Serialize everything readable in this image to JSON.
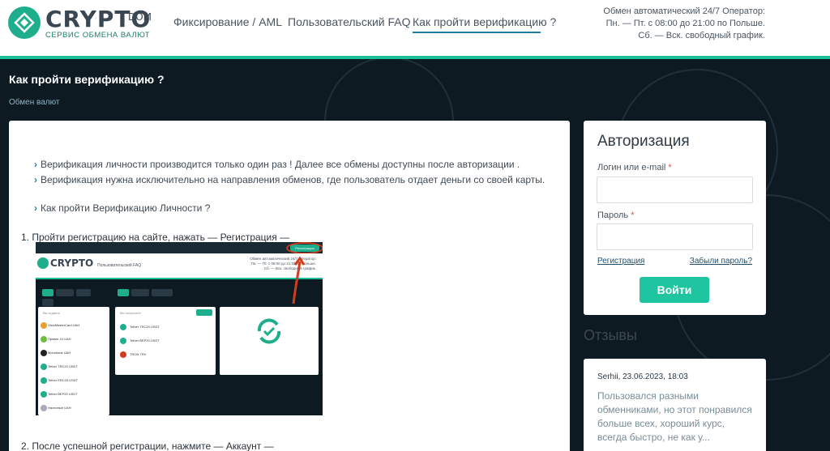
{
  "header": {
    "logo_text": "CRYPTO",
    "logo_dom": "DOM",
    "logo_sub": "СЕРВИС  ОБМЕНА  ВАЛЮТ",
    "nav": [
      {
        "label": "Фиксирование / AML"
      },
      {
        "label": "Пользовательский FAQ"
      },
      {
        "label": "Как пройти верификацию ?"
      }
    ],
    "ops_lines": [
      "Обмен автоматический 24/7 Оператор:",
      "Пн. — Пт. с 08:00 до 21:00 по Польше.",
      "Сб. — Вск. свободный график."
    ]
  },
  "page": {
    "title": "Как пройти верификацию ?",
    "breadcrumb": "Обмен валют"
  },
  "article": {
    "bullets": [
      "Верификация личности производится только один раз ! Далее все обмены доступны после авторизации .",
      "Верификация нужна исключительно на направления обменов, где пользователь отдает деньги со своей карты.",
      "Как пройти Верификацию Личности ?"
    ],
    "step1": "1. Пройти регистрацию на сайте, нажать — Регистрация —",
    "step2": "2. После успешной регистрации, нажмите — Аккаунт —",
    "shot": {
      "logo": "CRYPTO",
      "nav": "Пользовательский FAQ",
      "ops": [
        "Обмен автоматический 24/7 Оператор:",
        "Пн. — Пт. с 08:00 до 21:00 по Польше.",
        "Сб. — Вск. свободный график."
      ],
      "reg_button": "Регистрация",
      "left_rows": [
        "Visa/MasterCard UAH",
        "Приват 24 UAH",
        "Monobank UAH",
        "Tether TRC20 USDT",
        "Tether ERC20 USDT",
        "Tether BEP20 USDT",
        "Наличные UAH"
      ],
      "mid_rows": [
        "Tether TRC20 USDT",
        "Tether BEP20 USDT",
        "TRON TRX"
      ]
    }
  },
  "auth": {
    "title": "Авторизация",
    "login_label": "Логин или e-mail",
    "password_label": "Пароль",
    "required_mark": "*",
    "register_link": "Регистрация",
    "forgot_link": "Забыли пароль?",
    "submit": "Войти"
  },
  "reviews": {
    "heading": "Отзывы",
    "items": [
      {
        "meta": "Serhii, 23.06.2023, 18:03",
        "text": "Пользовался разными обменниками, но этот понравился больше всех, хороший курс, всегда быстро, не как у..."
      }
    ]
  },
  "colors": {
    "accent": "#1bbf9a",
    "dark_bg": "#0d1a22",
    "link": "#1f7ca8"
  }
}
